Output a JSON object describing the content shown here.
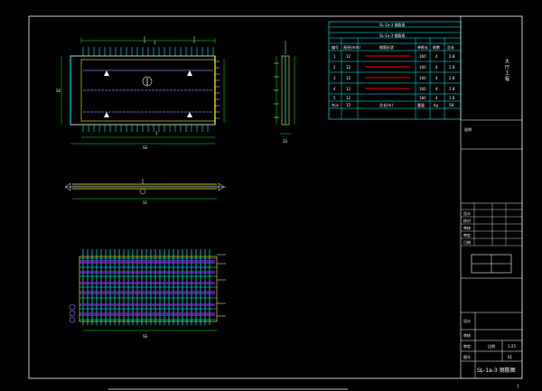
{
  "colors": {
    "background": "#000000",
    "frame": "#ffffff",
    "outline": "#ffffff",
    "rebar_main": "#00ffff",
    "rebar_transverse": "#8080ff",
    "dimension": "#00ff00",
    "panel_edge": "#ffff00",
    "hatch": "#8a2be2",
    "table_line": "#00ffff",
    "table_highlight": "#ff0000",
    "text_light": "#ffffff"
  },
  "plan_view": {
    "dim_top": "1",
    "dim_bottom": "1",
    "dim_total": "SS",
    "side_label": "SS",
    "center_mark": "①"
  },
  "section_view": {
    "dim_label": "33"
  },
  "elevation_view": {
    "dim_label": "11",
    "center_mark": "①"
  },
  "reinforcement_view": {
    "dim_label": "SS"
  },
  "rebar_table": {
    "title": "SL-1a-3 钢筋表",
    "subtitle": "SL-1a-3 钢筋表",
    "header": [
      "编号",
      "直径(mm)",
      "钢筋形状",
      "单根长",
      "根数",
      "总长"
    ],
    "rows": [
      {
        "mark": "1",
        "dia": "12",
        "len": "160",
        "count": "4",
        "total": "2.8"
      },
      {
        "mark": "2",
        "dia": "12",
        "len": "160",
        "count": "4",
        "total": "2.8"
      },
      {
        "mark": "3",
        "dia": "12",
        "len": "160",
        "count": "4",
        "total": "2.8"
      },
      {
        "mark": "4",
        "dia": "12",
        "len": "160",
        "count": "4",
        "total": "2.8"
      },
      {
        "mark": "5",
        "dia": "12",
        "len": "160",
        "count": "4",
        "total": "2.8"
      }
    ],
    "footer": [
      "合计",
      "12",
      "总长(m)",
      "重量",
      "kg",
      "58"
    ]
  },
  "title_block": {
    "project": "大 厅 工 程",
    "note": "说明",
    "designer": "设计",
    "checker": "审核",
    "approver": "审定",
    "scale_label": "比例",
    "scale_value": "1:25",
    "sheet_label": "图号",
    "sheet_value": "01",
    "drawing_title": "SL-1a-3 钢筋图",
    "rows": [
      "设计",
      "校对",
      "审核",
      "审定",
      "日期"
    ]
  },
  "page_number": "1"
}
